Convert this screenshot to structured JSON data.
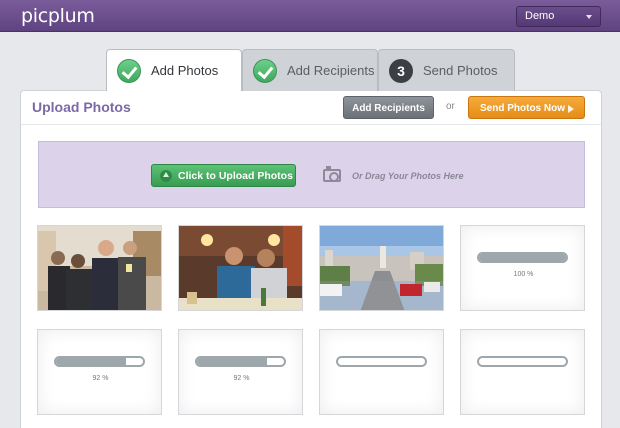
{
  "app": {
    "logo": "picplum"
  },
  "header": {
    "user_menu_value": "Demo"
  },
  "steps": [
    {
      "label": "Add Photos",
      "status": "done"
    },
    {
      "label": "Add Recipients",
      "status": "done"
    },
    {
      "label": "Send Photos",
      "number": "3",
      "status": "pending"
    }
  ],
  "panel": {
    "title": "Upload Photos",
    "add_recipients_label": "Add Recipients",
    "or_label": "or",
    "send_label": "Send Photos Now"
  },
  "dropzone": {
    "upload_label": "Click to Upload Photos",
    "drag_label": "Or Drag Your Photos Here"
  },
  "photos": [
    {
      "kind": "photo",
      "subject": "group of four men"
    },
    {
      "kind": "photo",
      "subject": "two men at restaurant"
    },
    {
      "kind": "photo",
      "subject": "city street view"
    },
    {
      "kind": "progress",
      "progress": 1.0,
      "progress_label": "100 %"
    },
    {
      "kind": "progress",
      "progress": 0.92,
      "progress_label": "92 %"
    },
    {
      "kind": "progress",
      "progress": 0.92,
      "progress_label": "92 %"
    },
    {
      "kind": "progress",
      "progress": 0.0,
      "progress_label": ""
    },
    {
      "kind": "progress",
      "progress": 0.0,
      "progress_label": ""
    }
  ],
  "colors": {
    "brand": "#6b4f8f",
    "accent_green": "#3fa85e",
    "accent_orange": "#e58c17"
  }
}
